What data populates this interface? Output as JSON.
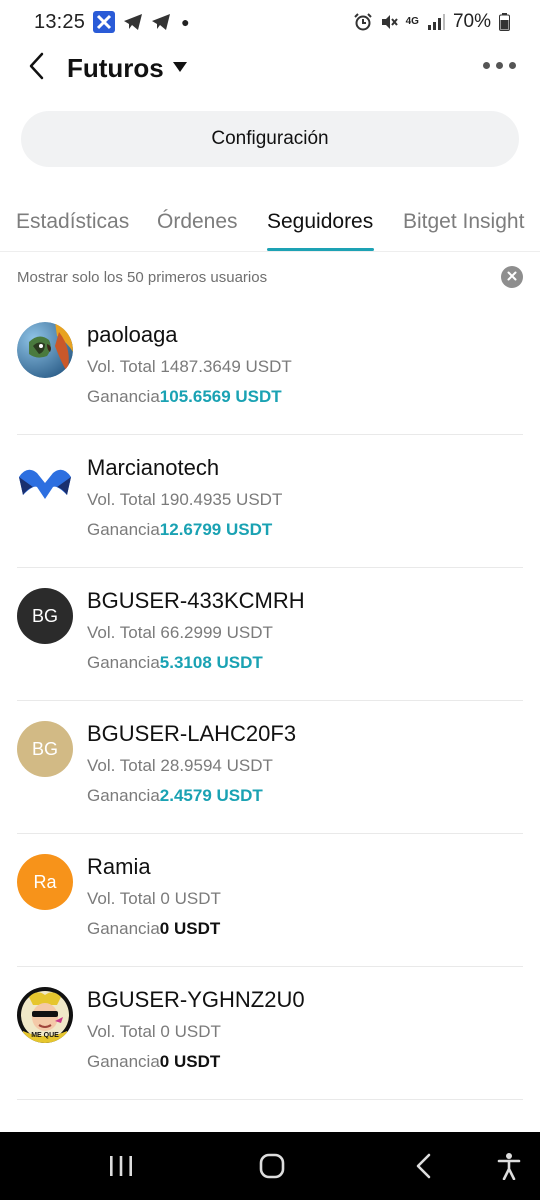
{
  "status_bar": {
    "time": "13:25",
    "battery": "70%",
    "network": "4G",
    "icons": [
      "app-x-icon",
      "telegram-icon",
      "telegram-icon",
      "alarm-icon",
      "mute-icon",
      "signal-icon",
      "battery-icon"
    ]
  },
  "header": {
    "title": "Futuros",
    "back_icon": "chevron-left-icon",
    "dropdown_icon": "caret-down-icon",
    "more_icon": "more-dots-icon"
  },
  "config_button": {
    "label": "Configuración"
  },
  "tabs": [
    {
      "label": "Estadísticas",
      "active": false
    },
    {
      "label": "Órdenes",
      "active": false
    },
    {
      "label": "Seguidores",
      "active": true
    },
    {
      "label": "Bitget Insight",
      "active": false
    }
  ],
  "notice": {
    "text": "Mostrar solo los 50 primeros usuarios"
  },
  "labels": {
    "vol_prefix": "Vol. Total",
    "gain_prefix": "Ganancia"
  },
  "followers": [
    {
      "name": "paoloaga",
      "volume": "1487.3649 USDT",
      "profit": "105.6569 USDT",
      "avatar": "parrot-photo",
      "positive": true
    },
    {
      "name": "Marcianotech",
      "volume": "190.4935 USDT",
      "profit": "12.6799 USDT",
      "avatar": "m-logo",
      "positive": true
    },
    {
      "name": "BGUSER-433KCMRH",
      "volume": "66.2999 USDT",
      "profit": "5.3108 USDT",
      "avatar_text": "BG",
      "avatar_color": "#2b2b2b",
      "positive": true
    },
    {
      "name": "BGUSER-LAHC20F3",
      "volume": "28.9594 USDT",
      "profit": "2.4579 USDT",
      "avatar_text": "BG",
      "avatar_color": "#d2ba85",
      "positive": true
    },
    {
      "name": "Ramia",
      "volume": "0 USDT",
      "profit": "0 USDT",
      "avatar_text": "Ra",
      "avatar_color": "#f7931a",
      "positive": false
    },
    {
      "name": "BGUSER-YGHNZ2U0",
      "volume": "0 USDT",
      "profit": "0 USDT",
      "avatar": "meme-cartoon",
      "positive": false
    }
  ],
  "colors": {
    "accent": "#1aa2b3",
    "tab_underline": "#1da2b4",
    "nav_bg": "#000000"
  },
  "nav_bar": {
    "icons": [
      "recent-apps-icon",
      "home-icon",
      "back-icon",
      "accessibility-icon"
    ]
  }
}
